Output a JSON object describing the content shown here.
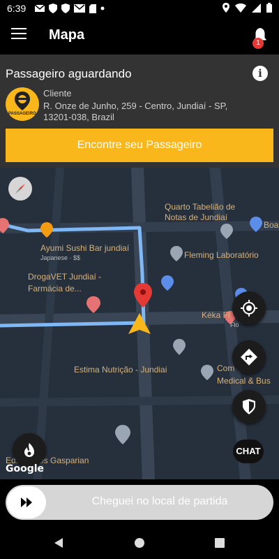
{
  "status_bar": {
    "time": "6:39",
    "notifications": [
      "gmail-icon",
      "shield-icon",
      "shield-icon",
      "mail-icon",
      "sd-card-icon",
      "dot-icon"
    ],
    "system": [
      "location-icon",
      "wifi-icon",
      "signal-icon",
      "battery-icon"
    ]
  },
  "app_bar": {
    "title": "Mapa",
    "notification_count": "1"
  },
  "ride": {
    "status": "Passageiro aguardando",
    "client_label": "Cliente",
    "address": "R. Onze de Junho, 259 - Centro, Jundiaí - SP, 13201-038, Brazil",
    "logo_text": "PASSAGEIRO",
    "find_button": "Encontre seu Passageiro"
  },
  "map": {
    "pois": {
      "quarto": "Quarto Tabelião de Notas de Jundiaí",
      "boa": "Boa",
      "ayumi": "Ayumi Sushi Bar jundiaí",
      "ayumi_sub": "Japanese · $$",
      "fleming": "Fleming Laboratório",
      "drogavet": "DrogaVET Jundiaí - Farmácia de...",
      "keka": "Kéka Fl",
      "keka2": "Flo",
      "estima": "Estima Nutrição - Jundiai",
      "comercial": "Com",
      "comercial2": "Medical & Bus",
      "marcos": "Ed. Marcos Gasparian"
    },
    "attribution": "Google",
    "chat_label": "CHAT"
  },
  "arrival_slider": {
    "label": "Cheguei no local de partida"
  },
  "colors": {
    "accent": "#f9b71c",
    "route": "#7fb8f5",
    "map_bg": "#26303d",
    "panel": "#333333"
  }
}
